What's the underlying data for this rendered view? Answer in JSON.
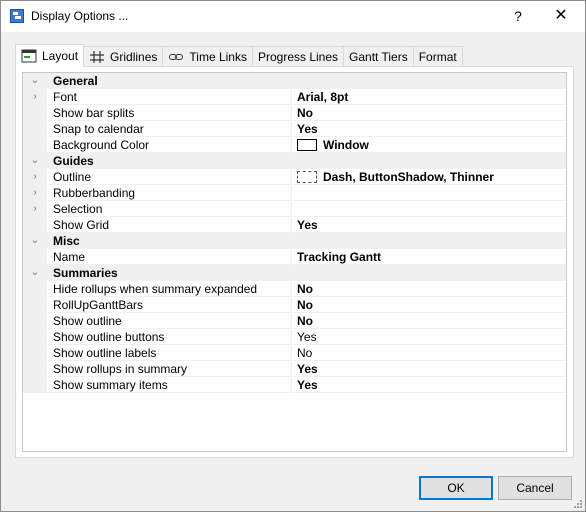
{
  "window": {
    "title": "Display Options ...",
    "help_glyph": "?",
    "close_glyph": "✕"
  },
  "tabs": [
    {
      "label": "Layout",
      "icon": "layout-icon",
      "active": true
    },
    {
      "label": "Gridlines",
      "icon": "grid-icon",
      "active": false
    },
    {
      "label": "Time Links",
      "icon": "link-icon",
      "active": false
    },
    {
      "label": "Progress Lines",
      "icon": "",
      "active": false
    },
    {
      "label": "Gantt Tiers",
      "icon": "",
      "active": false
    },
    {
      "label": "Format",
      "icon": "",
      "active": false
    }
  ],
  "categories": {
    "general": "General",
    "guides": "Guides",
    "misc": "Misc",
    "summaries": "Summaries"
  },
  "properties": {
    "font": {
      "name": "Font",
      "value": "Arial, 8pt"
    },
    "show_bar_splits": {
      "name": "Show bar splits",
      "value": "No"
    },
    "snap_to_calendar": {
      "name": "Snap to calendar",
      "value": "Yes"
    },
    "background_color": {
      "name": "Background Color",
      "value": "Window"
    },
    "outline": {
      "name": "Outline",
      "value": "Dash, ButtonShadow, Thinner"
    },
    "rubberbanding": {
      "name": "Rubberbanding",
      "value": ""
    },
    "selection": {
      "name": "Selection",
      "value": ""
    },
    "show_grid": {
      "name": "Show Grid",
      "value": "Yes"
    },
    "misc_name": {
      "name": "Name",
      "value": "Tracking Gantt"
    },
    "hide_rollups": {
      "name": "Hide rollups when summary expanded",
      "value": "No"
    },
    "rollup_gantt_bars": {
      "name": "RollUpGanttBars",
      "value": "No"
    },
    "show_outline": {
      "name": "Show outline",
      "value": "No"
    },
    "show_outline_buttons": {
      "name": "Show outline buttons",
      "value": "Yes"
    },
    "show_outline_labels": {
      "name": "Show outline labels",
      "value": "No"
    },
    "show_rollups_in_summary": {
      "name": "Show rollups in summary",
      "value": "Yes"
    },
    "show_summary_items": {
      "name": "Show summary items",
      "value": "Yes"
    }
  },
  "glyphs": {
    "collapse": "⌄",
    "expand": "›"
  },
  "buttons": {
    "ok": "OK",
    "cancel": "Cancel"
  },
  "colors": {
    "accent": "#0078d7",
    "category_bg": "#f0f0f0"
  }
}
